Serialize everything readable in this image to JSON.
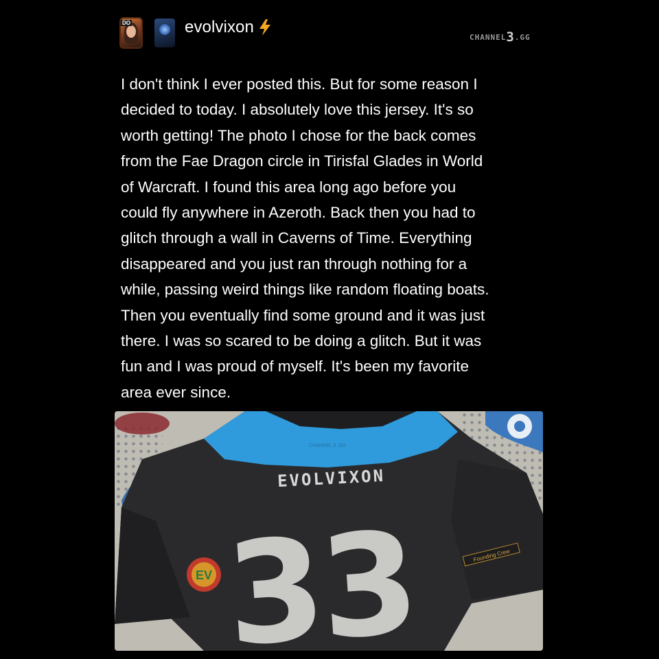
{
  "header": {
    "username": "evolvixon",
    "avatar1_icon": "portrait-avatar-icon",
    "avatar2_icon": "world-of-warcraft-avatar-icon",
    "bolt_icon": "lightning-bolt-icon",
    "bolt_color": "#f5a623",
    "watermark_left": "CHANNEL",
    "watermark_three": "3",
    "watermark_right": ".GG"
  },
  "post": {
    "text": "I don't think I ever posted this. But for some reason I\ndecided to today. I absolutely love this jersey. It's so\nworth getting! The photo I chose for the back comes\nfrom the Fae Dragon circle in Tirisfal Glades in World\nof Warcraft. I found this area long ago before you\ncould fly anywhere in Azeroth. Back then you had to\nglitch through a wall in Caverns of Time. Everything\ndisappeared and you just ran through nothing for a\nwhile, passing weird things like random floating boats.\nThen you eventually find some ground and it was just\nthere. I was so scared to be doing a glitch. But it was\nfun and I was proud of myself. It's been my favorite\narea ever since."
  },
  "photo": {
    "jersey_name": "EVOLVIXON",
    "jersey_number": "33",
    "jersey_logo": "CHANNEL 3 .GG",
    "patch_label": "EV",
    "sleeve_tag": "Founding Crew",
    "jersey_color": "#2a2a2c",
    "shoulder_color": "#2f9bdc"
  }
}
